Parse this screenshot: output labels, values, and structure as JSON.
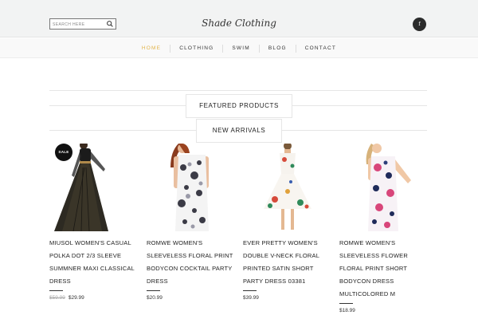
{
  "header": {
    "search_placeholder": "SEARCH HERE",
    "logo": "Shade Clothing",
    "social_label": "f"
  },
  "nav": {
    "items": [
      "HOME",
      "CLOTHING",
      "SWIM",
      "BLOG",
      "CONTACT"
    ],
    "active_index": 0,
    "active_color": "#e2b44a"
  },
  "sections": {
    "featured": "FEATURED PRODUCTS",
    "new_arrivals": "NEW ARRIVALS"
  },
  "products": [
    {
      "title": "MIUSOL WOMEN'S CASUAL POLKA DOT 2/3 SLEEVE SUMMNER MAXI CLASSICAL DRESS",
      "old_price": "$59.99",
      "price": "$29.99",
      "badge": "SALE"
    },
    {
      "title": "ROMWE WOMEN'S SLEEVELESS FLORAL PRINT BODYCON COCKTAIL PARTY DRESS",
      "old_price": "",
      "price": "$20.99",
      "badge": ""
    },
    {
      "title": "EVER PRETTY WOMEN'S DOUBLE V-NECK FLORAL PRINTED SATIN SHORT PARTY DRESS 03381",
      "old_price": "",
      "price": "$39.99",
      "badge": ""
    },
    {
      "title": "ROMWE WOMEN'S SLEEVELESS FLOWER FLORAL PRINT SHORT BODYCON DRESS MULTICOLORED M",
      "old_price": "",
      "price": "$18.99",
      "badge": ""
    }
  ]
}
